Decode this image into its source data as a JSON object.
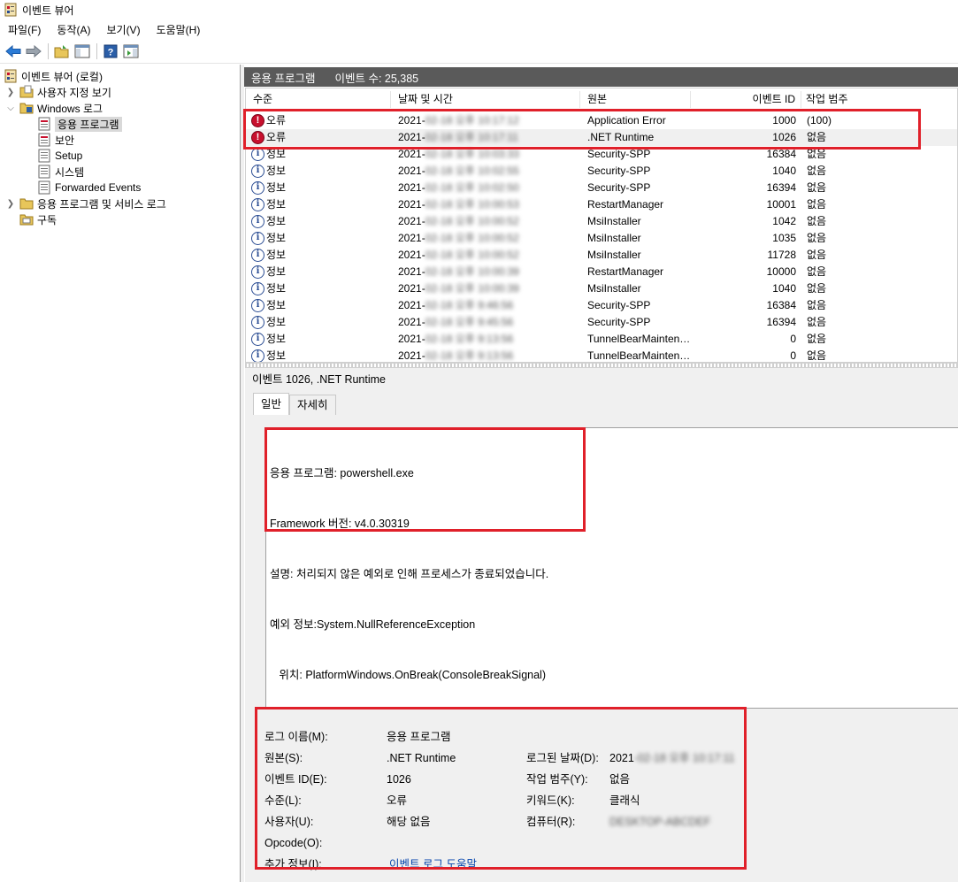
{
  "window": {
    "title": "이벤트 뷰어"
  },
  "menu": [
    "파일(F)",
    "동작(A)",
    "보기(V)",
    "도움말(H)"
  ],
  "toolbar": {
    "icons": [
      "back-arrow-icon",
      "forward-arrow-icon",
      "open-folder-icon",
      "show-hide-tree-icon",
      "help-icon",
      "show-hide-action-pane-icon"
    ]
  },
  "tree": {
    "root": "이벤트 뷰어 (로컬)",
    "custom_views": "사용자 지정 보기",
    "windows_logs": "Windows 로그",
    "application": "응용 프로그램",
    "security": "보안",
    "setup": "Setup",
    "system": "시스템",
    "forwarded": "Forwarded Events",
    "app_services": "응용 프로그램 및 서비스 로그",
    "subscriptions": "구독"
  },
  "pane": {
    "title": "응용 프로그램",
    "event_count": "이벤트 수: 25,385"
  },
  "columns": {
    "level": "수준",
    "datetime": "날짜 및 시간",
    "source": "원본",
    "event_id": "이벤트 ID",
    "category": "작업 범주"
  },
  "events": [
    {
      "level": "오류",
      "type": "error",
      "date_prefix": "2021-",
      "date_masked": "02-18 오후 10:17:12",
      "source": "Application Error",
      "id": "1000",
      "category": "(100)"
    },
    {
      "level": "오류",
      "type": "error",
      "date_prefix": "2021-",
      "date_masked": "02-18 오후 10:17:11",
      "source": ".NET Runtime",
      "id": "1026",
      "category": "없음"
    },
    {
      "level": "정보",
      "type": "info",
      "date_prefix": "2021-",
      "date_masked": "02-18 오후 10:03:33",
      "source": "Security-SPP",
      "id": "16384",
      "category": "없음"
    },
    {
      "level": "정보",
      "type": "info",
      "date_prefix": "2021-",
      "date_masked": "02-18 오후 10:02:55",
      "source": "Security-SPP",
      "id": "1040",
      "category": "없음"
    },
    {
      "level": "정보",
      "type": "info",
      "date_prefix": "2021-",
      "date_masked": "02-18 오후 10:02:50",
      "source": "Security-SPP",
      "id": "16394",
      "category": "없음"
    },
    {
      "level": "정보",
      "type": "info",
      "date_prefix": "2021-",
      "date_masked": "02-18 오후 10:00:53",
      "source": "RestartManager",
      "id": "10001",
      "category": "없음"
    },
    {
      "level": "정보",
      "type": "info",
      "date_prefix": "2021-",
      "date_masked": "02-18 오후 10:00:52",
      "source": "MsiInstaller",
      "id": "1042",
      "category": "없음"
    },
    {
      "level": "정보",
      "type": "info",
      "date_prefix": "2021-",
      "date_masked": "02-18 오후 10:00:52",
      "source": "MsiInstaller",
      "id": "1035",
      "category": "없음"
    },
    {
      "level": "정보",
      "type": "info",
      "date_prefix": "2021-",
      "date_masked": "02-18 오후 10:00:52",
      "source": "MsiInstaller",
      "id": "11728",
      "category": "없음"
    },
    {
      "level": "정보",
      "type": "info",
      "date_prefix": "2021-",
      "date_masked": "02-18 오후 10:00:39",
      "source": "RestartManager",
      "id": "10000",
      "category": "없음"
    },
    {
      "level": "정보",
      "type": "info",
      "date_prefix": "2021-",
      "date_masked": "02-18 오후 10:00:39",
      "source": "MsiInstaller",
      "id": "1040",
      "category": "없음"
    },
    {
      "level": "정보",
      "type": "info",
      "date_prefix": "2021-",
      "date_masked": "02-18 오후 9:46:56",
      "source": "Security-SPP",
      "id": "16384",
      "category": "없음"
    },
    {
      "level": "정보",
      "type": "info",
      "date_prefix": "2021-",
      "date_masked": "02-18 오후 9:45:56",
      "source": "Security-SPP",
      "id": "16394",
      "category": "없음"
    },
    {
      "level": "정보",
      "type": "info",
      "date_prefix": "2021-",
      "date_masked": "02-18 오후 9:13:56",
      "source": "TunnelBearMainten…",
      "id": "0",
      "category": "없음"
    },
    {
      "level": "정보",
      "type": "info",
      "date_prefix": "2021-",
      "date_masked": "02-18 오후 9:13:56",
      "source": "TunnelBearMainten…",
      "id": "0",
      "category": "없음"
    }
  ],
  "detail": {
    "title": "이벤트 1026, .NET Runtime",
    "tabs": [
      "일반",
      "자세히"
    ],
    "text_lines": [
      "응용 프로그램: powershell.exe",
      "Framework 버전: v4.0.30319",
      "설명: 처리되지 않은 예외로 인해 프로세스가 종료되었습니다.",
      "예외 정보:System.NullReferenceException",
      "   위치: PlatformWindows.OnBreak(ConsoleBreakSignal)"
    ],
    "fields": {
      "log_name_label": "로그 이름(M):",
      "log_name": "응용 프로그램",
      "source_label": "원본(S):",
      "source": ".NET Runtime",
      "logged_label": "로그된 날짜(D):",
      "logged_prefix": "2021",
      "logged_masked": "-02-18 오후 10:17:11",
      "event_id_label": "이벤트 ID(E):",
      "event_id": "1026",
      "category_label": "작업 범주(Y):",
      "category": "없음",
      "level_label": "수준(L):",
      "level": "오류",
      "keyword_label": "키워드(K):",
      "keyword": "클래식",
      "user_label": "사용자(U):",
      "user": "해당 없음",
      "computer_label": "컴퓨터(R):",
      "computer_masked": "DESKTOP-ABCDEF",
      "opcode_label": "Opcode(O):",
      "opcode": "",
      "more_label": "추가 정보(I):",
      "more_link": "이벤트 로그 도움말"
    }
  },
  "colors": {
    "highlight_box": "#e0202a",
    "header_bar": "#5a5a5a",
    "error_icon": "#c8102e",
    "info_icon": "#2a4c93",
    "link": "#0645ad"
  }
}
